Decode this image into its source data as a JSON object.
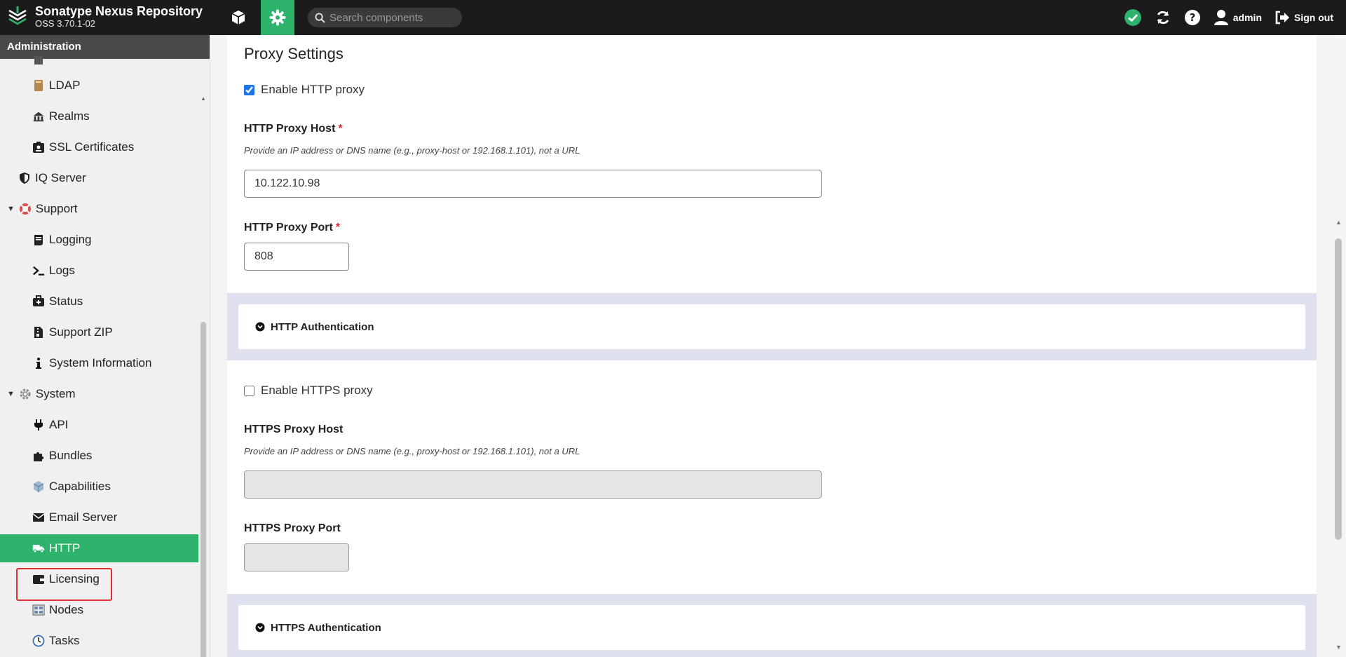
{
  "header": {
    "app_title": "Sonatype Nexus Repository",
    "version": "OSS 3.70.1-02",
    "search_placeholder": "Search components",
    "user_label": "admin",
    "signout_label": "Sign out",
    "accent_color": "#2db36c"
  },
  "sidebar": {
    "title": "Administration",
    "items": [
      {
        "label": "LDAP",
        "icon": "book-icon"
      },
      {
        "label": "Realms",
        "icon": "realms-icon"
      },
      {
        "label": "SSL Certificates",
        "icon": "certificate-icon"
      },
      {
        "label": "IQ Server",
        "icon": "shield-icon"
      },
      {
        "label": "Support",
        "icon": "lifebuoy-icon"
      },
      {
        "label": "Logging",
        "icon": "scroll-icon"
      },
      {
        "label": "Logs",
        "icon": "terminal-icon"
      },
      {
        "label": "Status",
        "icon": "medkit-icon"
      },
      {
        "label": "Support ZIP",
        "icon": "file-zip-icon"
      },
      {
        "label": "System Information",
        "icon": "info-icon"
      },
      {
        "label": "System",
        "icon": "gear-icon"
      },
      {
        "label": "API",
        "icon": "plug-icon"
      },
      {
        "label": "Bundles",
        "icon": "puzzle-icon"
      },
      {
        "label": "Capabilities",
        "icon": "cube-icon"
      },
      {
        "label": "Email Server",
        "icon": "envelope-icon"
      },
      {
        "label": "HTTP",
        "icon": "truck-icon"
      },
      {
        "label": "Licensing",
        "icon": "wallet-icon"
      },
      {
        "label": "Nodes",
        "icon": "nodes-icon"
      },
      {
        "label": "Tasks",
        "icon": "clock-icon"
      }
    ]
  },
  "main": {
    "title": "Proxy Settings",
    "http": {
      "enable_label": "Enable HTTP proxy",
      "enabled": true,
      "host_label": "HTTP Proxy Host",
      "host_help": "Provide an IP address or DNS name (e.g., proxy-host or 192.168.1.101), not a URL",
      "host_value": "10.122.10.98",
      "port_label": "HTTP Proxy Port",
      "port_value": "808",
      "auth_label": "HTTP Authentication"
    },
    "https": {
      "enable_label": "Enable HTTPS proxy",
      "enabled": false,
      "host_label": "HTTPS Proxy Host",
      "host_help": "Provide an IP address or DNS name (e.g., proxy-host or 192.168.1.101), not a URL",
      "host_value": "",
      "port_label": "HTTPS Proxy Port",
      "port_value": "",
      "auth_label": "HTTPS Authentication"
    },
    "required_mark": "*"
  }
}
